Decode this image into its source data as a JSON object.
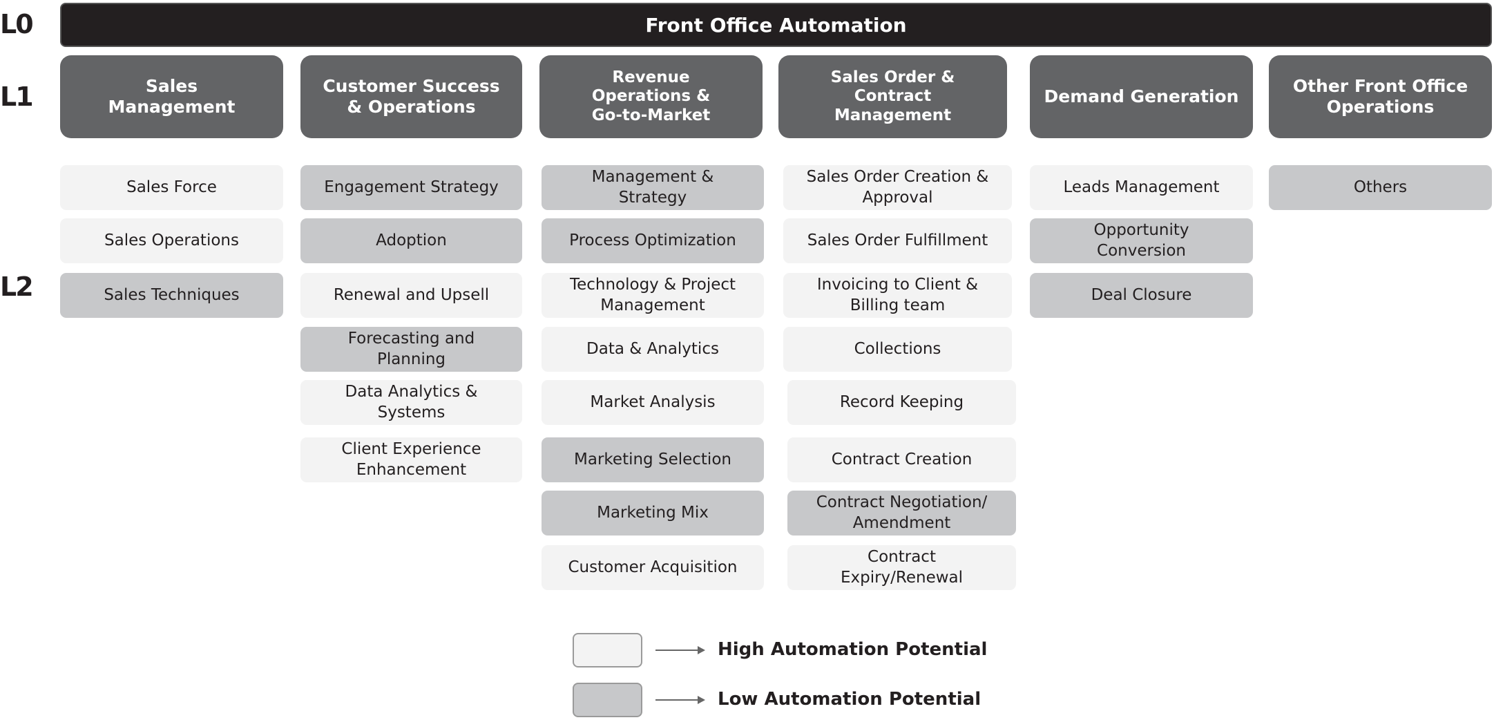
{
  "levels": {
    "l0": "L0",
    "l1": "L1",
    "l2": "L2"
  },
  "title": "Front Office Automation",
  "colors": {
    "l0": "#231f20",
    "l1": "#636466",
    "high": "#f3f3f3",
    "low": "#c7c8ca"
  },
  "columns": [
    {
      "label": "Sales\nManagement",
      "items": [
        {
          "label": "Sales Force",
          "potential": "high"
        },
        {
          "label": "Sales Operations",
          "potential": "high"
        },
        {
          "label": "Sales Techniques",
          "potential": "low"
        }
      ]
    },
    {
      "label": "Customer Success\n& Operations",
      "items": [
        {
          "label": "Engagement Strategy",
          "potential": "low"
        },
        {
          "label": "Adoption",
          "potential": "low"
        },
        {
          "label": "Renewal and Upsell",
          "potential": "high"
        },
        {
          "label": "Forecasting and\nPlanning",
          "potential": "low"
        },
        {
          "label": "Data Analytics &\nSystems",
          "potential": "high"
        },
        {
          "label": "Client Experience\nEnhancement",
          "potential": "high"
        }
      ]
    },
    {
      "label": "Revenue\nOperations &\nGo-to-Market",
      "items": [
        {
          "label": "Management &\nStrategy",
          "potential": "low"
        },
        {
          "label": "Process Optimization",
          "potential": "low"
        },
        {
          "label": "Technology & Project\nManagement",
          "potential": "high"
        },
        {
          "label": "Data & Analytics",
          "potential": "high"
        },
        {
          "label": "Market Analysis",
          "potential": "high"
        },
        {
          "label": "Marketing Selection",
          "potential": "low"
        },
        {
          "label": "Marketing Mix",
          "potential": "low"
        },
        {
          "label": "Customer Acquisition",
          "potential": "high"
        }
      ]
    },
    {
      "label": "Sales Order &\nContract\nManagement",
      "items": [
        {
          "label": "Sales Order Creation &\nApproval",
          "potential": "high"
        },
        {
          "label": "Sales Order Fulfillment",
          "potential": "high"
        },
        {
          "label": "Invoicing to Client &\nBilling team",
          "potential": "high"
        },
        {
          "label": "Collections",
          "potential": "high"
        },
        {
          "label": "Record Keeping",
          "potential": "high"
        },
        {
          "label": "Contract Creation",
          "potential": "high"
        },
        {
          "label": "Contract Negotiation/\nAmendment",
          "potential": "low"
        },
        {
          "label": "Contract\nExpiry/Renewal",
          "potential": "high"
        }
      ]
    },
    {
      "label": "Demand Generation",
      "items": [
        {
          "label": "Leads Management",
          "potential": "high"
        },
        {
          "label": "Opportunity\nConversion",
          "potential": "low"
        },
        {
          "label": "Deal Closure",
          "potential": "low"
        }
      ]
    },
    {
      "label": "Other Front Office\nOperations",
      "items": [
        {
          "label": "Others",
          "potential": "low"
        }
      ]
    }
  ],
  "legend": {
    "high": "High Automation Potential",
    "low": "Low Automation Potential"
  }
}
